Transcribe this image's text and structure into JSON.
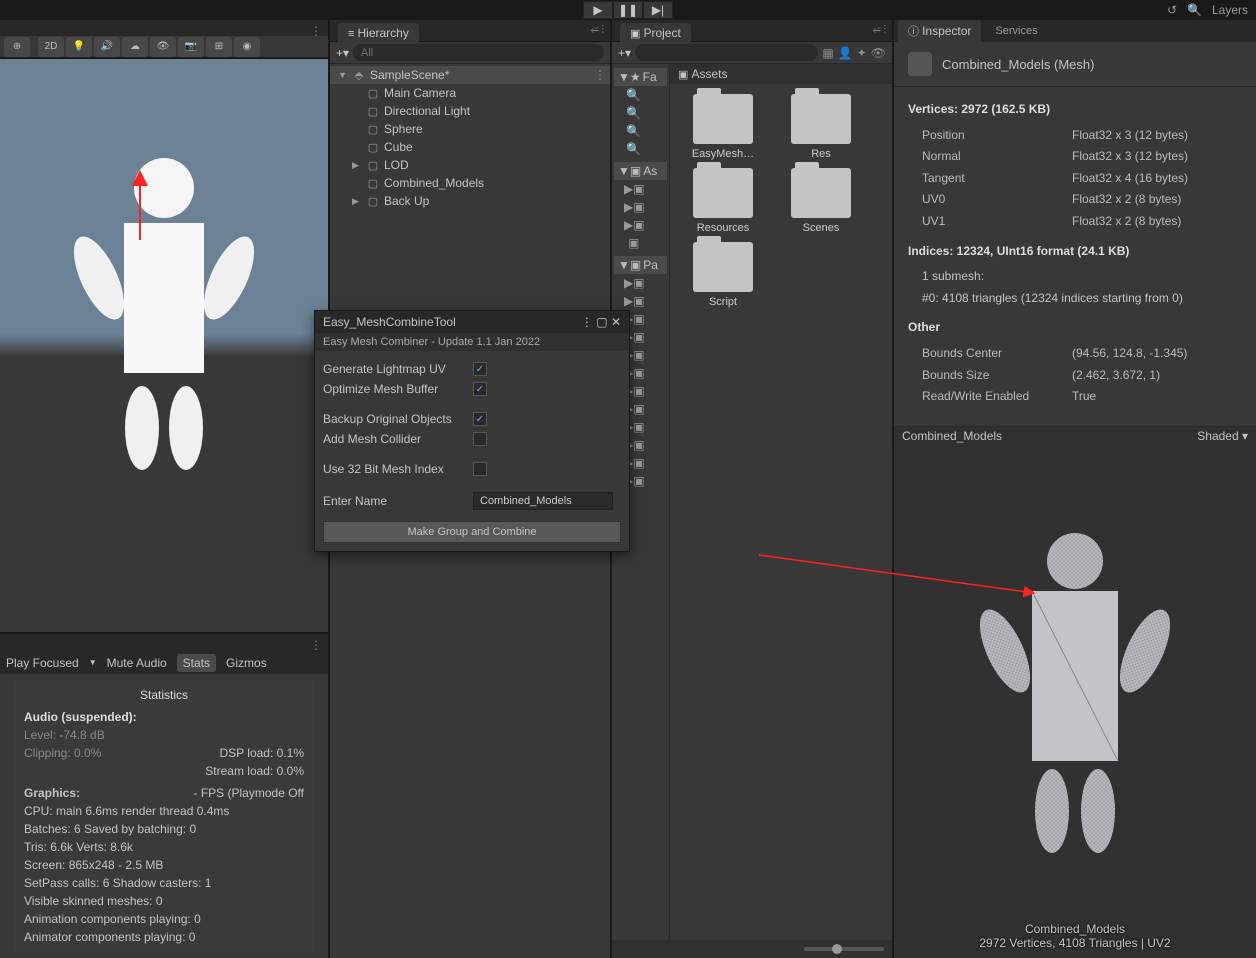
{
  "topbar": {
    "layers": "Layers"
  },
  "hierarchy": {
    "title": "Hierarchy",
    "search": "All",
    "scene": "SampleScene*",
    "items": [
      "Main Camera",
      "Directional Light",
      "Sphere",
      "Cube",
      "LOD",
      "Combined_Models",
      "Back Up"
    ]
  },
  "project": {
    "title": "Project",
    "breadcrumb": "Assets",
    "treeItems": [
      "Fa",
      "As",
      "Pa"
    ],
    "folders": [
      "EasyMesh…",
      "Res",
      "Resources",
      "Scenes",
      "Script"
    ]
  },
  "inspector": {
    "tab1": "Inspector",
    "tab2": "Services",
    "assetName": "Combined_Models (Mesh)",
    "verticesHeader": "Vertices: 2972 (162.5 KB)",
    "attrs": [
      {
        "k": "Position",
        "v": "Float32 x 3 (12 bytes)"
      },
      {
        "k": "Normal",
        "v": "Float32 x 3 (12 bytes)"
      },
      {
        "k": "Tangent",
        "v": "Float32 x 4 (16 bytes)"
      },
      {
        "k": "UV0",
        "v": "Float32 x 2 (8 bytes)"
      },
      {
        "k": "UV1",
        "v": "Float32 x 2 (8 bytes)"
      }
    ],
    "indicesHeader": "Indices: 12324, UInt16 format (24.1 KB)",
    "submesh": "1 submesh:",
    "submeshDetail": "#0: 4108 triangles (12324 indices starting from 0)",
    "otherHeader": "Other",
    "other": [
      {
        "k": "Bounds Center",
        "v": "(94.56, 124.8, -1.345)"
      },
      {
        "k": "Bounds Size",
        "v": "(2.462, 3.672, 1)"
      },
      {
        "k": "Read/Write Enabled",
        "v": "True"
      }
    ],
    "previewName": "Combined_Models",
    "previewMode": "Shaded",
    "previewFooter1": "Combined_Models",
    "previewFooter2": "2972 Vertices, 4108 Triangles | UV2"
  },
  "tool": {
    "title": "Easy_MeshCombineTool",
    "subtitle": "Easy Mesh Combiner - Update 1.1 Jan 2022",
    "opts": {
      "lightmap": "Generate Lightmap UV",
      "optimize": "Optimize Mesh Buffer",
      "backup": "Backup Original Objects",
      "collider": "Add Mesh Collider",
      "use32": "Use 32 Bit Mesh Index",
      "enterName": "Enter Name"
    },
    "nameValue": "Combined_Models",
    "button": "Make Group and Combine"
  },
  "game": {
    "playFocused": "Play Focused",
    "muteAudio": "Mute Audio",
    "stats": "Stats",
    "gizmos": "Gizmos"
  },
  "stats": {
    "title": "Statistics",
    "audio": "Audio (suspended):",
    "level": "Level: -74.8 dB",
    "clipping": "Clipping: 0.0%",
    "dsp": "DSP load: 0.1%",
    "stream": "Stream load: 0.0%",
    "graphics": "Graphics:",
    "fps": "- FPS (Playmode Off",
    "cpu": "CPU: main 6.6ms   render thread 0.4ms",
    "batches": "Batches: 6         Saved by batching: 0",
    "tris": "Tris: 6.6k        Verts: 8.6k",
    "screen": "Screen: 865x248 - 2.5 MB",
    "setpass": "SetPass calls: 6        Shadow casters: 1",
    "skinned": "Visible skinned meshes: 0",
    "anim1": "Animation components playing: 0",
    "anim2": "Animator components playing: 0"
  }
}
